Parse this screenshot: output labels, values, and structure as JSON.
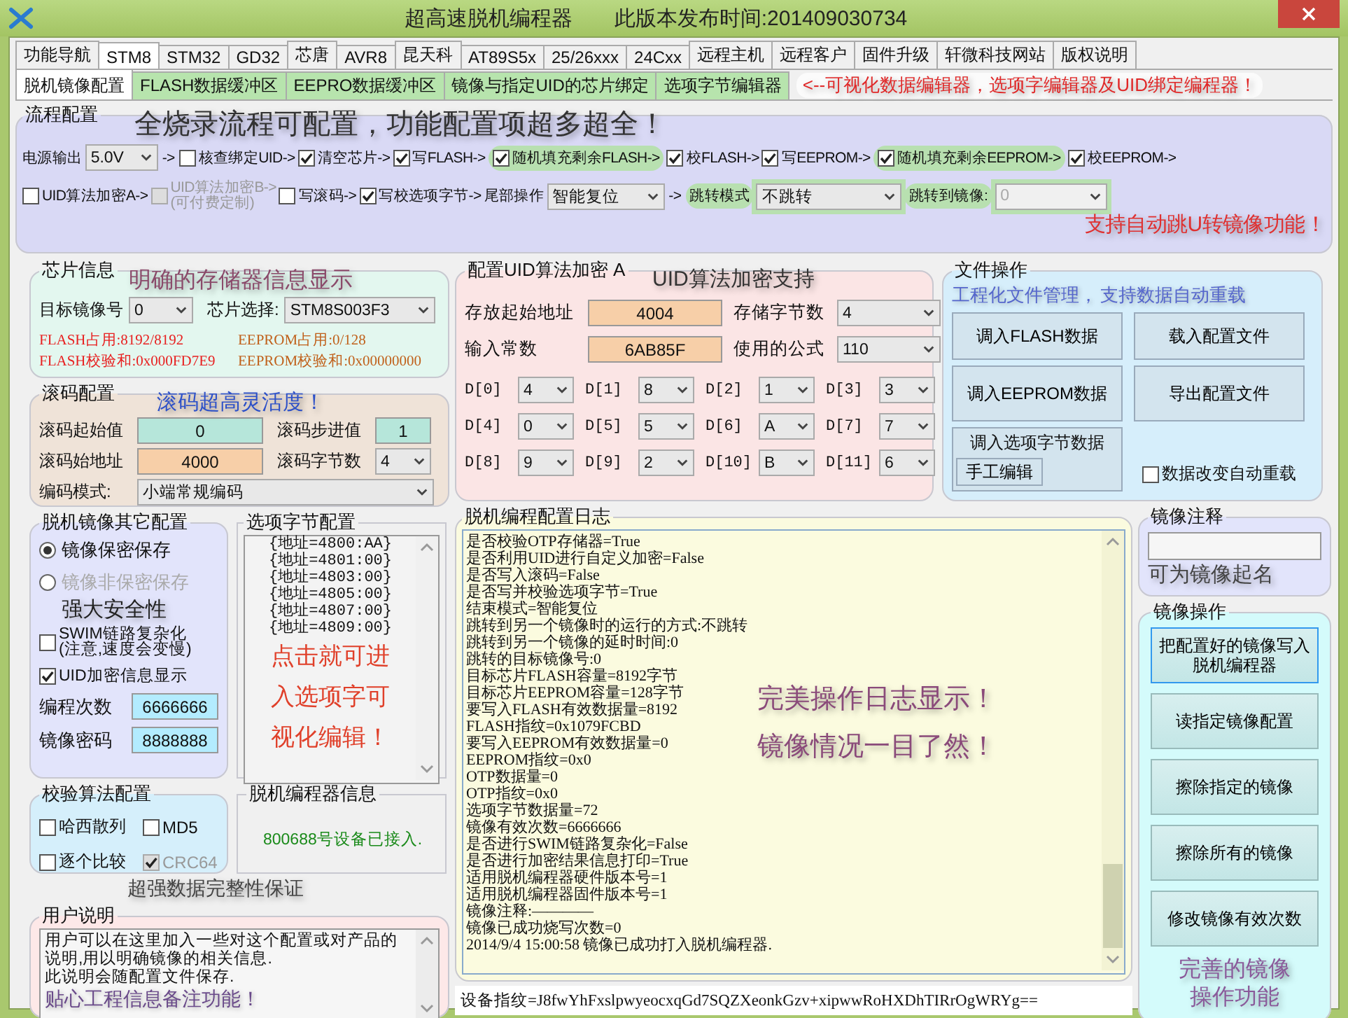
{
  "window": {
    "title": "超高速脱机编程器",
    "release": "此版本发布时间:201409030734"
  },
  "top_tabs": [
    {
      "label": "功能导航",
      "selected": false
    },
    {
      "label": "STM8",
      "selected": true
    },
    {
      "label": "STM32",
      "selected": false
    },
    {
      "label": "GD32",
      "selected": false
    },
    {
      "label": "芯唐",
      "selected": false
    },
    {
      "label": "AVR8",
      "selected": false
    },
    {
      "label": "昆天科",
      "selected": false
    },
    {
      "label": "AT89S5x",
      "selected": false
    },
    {
      "label": "25/26xxx",
      "selected": false
    },
    {
      "label": "24Cxx",
      "selected": false
    },
    {
      "label": "远程主机",
      "selected": false
    },
    {
      "label": "远程客户",
      "selected": false
    },
    {
      "label": "固件升级",
      "selected": false
    },
    {
      "label": "轩微科技网站",
      "selected": false
    },
    {
      "label": "版权说明",
      "selected": false
    }
  ],
  "sub_tabs": [
    {
      "label": "脱机镜像配置",
      "selected": true
    },
    {
      "label": "FLASH数据缓冲区",
      "selected": false
    },
    {
      "label": "EEPRO数据缓冲区",
      "selected": false
    },
    {
      "label": "镜像与指定UID的芯片绑定",
      "selected": false
    },
    {
      "label": "选项字节编辑器",
      "selected": false
    }
  ],
  "sub_tabs_callout": "<--可视化数据编辑器，选项字编辑器及UID绑定编程器！",
  "flow": {
    "title": "流程配置",
    "callout": "全烧录流程可配置，功能配置项超多超全！",
    "callout_2": "支持自动跳U转镜像功能！",
    "rows": [
      {
        "items": [
          {
            "kind": "label",
            "text": "电源输出",
            "highlight": false
          },
          {
            "kind": "select",
            "value": "5.0V",
            "disabled": false,
            "highlight": false
          },
          {
            "kind": "arrow",
            "text": "->"
          },
          {
            "kind": "check",
            "label": "核查绑定UID->",
            "checked": false,
            "disabled": false,
            "highlight": false
          },
          {
            "kind": "check",
            "label": "清空芯片->",
            "checked": true,
            "disabled": false,
            "highlight": false
          },
          {
            "kind": "check",
            "label": "写FLASH->",
            "checked": true,
            "disabled": false,
            "highlight": false
          },
          {
            "kind": "check",
            "label": "随机填充剩余FLASH->",
            "checked": true,
            "disabled": false,
            "highlight": true
          },
          {
            "kind": "check",
            "label": "校FLASH->",
            "checked": true,
            "disabled": false,
            "highlight": false
          },
          {
            "kind": "check",
            "label": "写EEPROM->",
            "checked": true,
            "disabled": false,
            "highlight": false
          },
          {
            "kind": "check",
            "label": "随机填充剩余EEPROM->",
            "checked": true,
            "disabled": false,
            "highlight": true
          },
          {
            "kind": "check",
            "label": "校EEPROM->",
            "checked": true,
            "disabled": false,
            "highlight": false
          }
        ]
      },
      {
        "items": [
          {
            "kind": "check",
            "label": "UID算法加密A->",
            "checked": false,
            "disabled": false,
            "highlight": false
          },
          {
            "kind": "check",
            "label": "UID算法加密B->",
            "note": "(可付费定制)",
            "checked": false,
            "disabled": true,
            "highlight": false
          },
          {
            "kind": "check",
            "label": "写滚码->",
            "checked": false,
            "disabled": false,
            "highlight": false
          },
          {
            "kind": "check",
            "label": "写校选项字节->",
            "checked": true,
            "disabled": false,
            "highlight": false
          },
          {
            "kind": "label",
            "text": "尾部操作",
            "highlight": false
          },
          {
            "kind": "select",
            "value": "智能复位",
            "disabled": false,
            "highlight": false
          },
          {
            "kind": "arrow",
            "text": "->"
          },
          {
            "kind": "label",
            "text": "跳转模式",
            "highlight": true
          },
          {
            "kind": "select",
            "value": "不跳转",
            "disabled": false,
            "highlight": true
          },
          {
            "kind": "label",
            "text": "跳转到镜像:",
            "highlight": true
          },
          {
            "kind": "select",
            "value": "0",
            "disabled": true,
            "highlight": true
          }
        ]
      }
    ]
  },
  "chip_info": {
    "title": "芯片信息",
    "callout": "明确的存储器信息显示",
    "target_label": "目标镜像号",
    "target_value": "0",
    "chip_label": "芯片选择:",
    "chip_value": "STM8S003F3",
    "stats": [
      {
        "text": "FLASH占用:8192/8192",
        "color": "#e82020"
      },
      {
        "text": "EEPROM占用:0/128",
        "color": "#c0601a"
      },
      {
        "text": "FLASH校验和:0x000FD7E9",
        "color": "#e82020"
      },
      {
        "text": "EEPROM校验和:0x00000000",
        "color": "#c0601a"
      }
    ]
  },
  "rolling": {
    "title": "滚码配置",
    "callout": "滚码超高灵活度！",
    "start": {
      "label": "滚码起始值",
      "value": "0"
    },
    "step": {
      "label": "滚码步进值",
      "value": "1"
    },
    "address": {
      "label": "滚码始地址",
      "value": "4000"
    },
    "bytes": {
      "label": "滚码字节数",
      "value": "4"
    },
    "mode": {
      "label": "编码模式:",
      "value": "小端常规编码"
    }
  },
  "uid": {
    "title": "配置UID算法加密 A",
    "callout": "UID算法加密支持",
    "store_addr": {
      "label": "存放起始地址",
      "value": "4004"
    },
    "store_bytes": {
      "label": "存储字节数",
      "value": "4"
    },
    "constant": {
      "label": "输入常数",
      "value": "6AB85F"
    },
    "formula": {
      "label": "使用的公式",
      "value": "110"
    },
    "d": [
      {
        "label": "D[0]",
        "value": "4"
      },
      {
        "label": "D[1]",
        "value": "8"
      },
      {
        "label": "D[2]",
        "value": "1"
      },
      {
        "label": "D[3]",
        "value": "3"
      },
      {
        "label": "D[4]",
        "value": "0"
      },
      {
        "label": "D[5]",
        "value": "5"
      },
      {
        "label": "D[6]",
        "value": "A"
      },
      {
        "label": "D[7]",
        "value": "7"
      },
      {
        "label": "D[8]",
        "value": "9"
      },
      {
        "label": "D[9]",
        "value": "2"
      },
      {
        "label": "D[10]",
        "value": "B"
      },
      {
        "label": "D[11]",
        "value": "6"
      }
    ]
  },
  "file_ops": {
    "title": "文件操作",
    "callout_lines": [
      "工程化文件管理，",
      "支持数据自动重载"
    ],
    "load_flash": "调入FLASH数据",
    "load_eeprom": "调入EEPROM数据",
    "load_option": "调入选项字节数据",
    "manual_edit": "手工编辑",
    "load_config": "载入配置文件",
    "export_config": "导出配置文件",
    "auto_reload": {
      "label": "数据改变自动重载",
      "checked": false
    }
  },
  "other_config": {
    "title": "脱机镜像其它配置",
    "callout": "强大安全性",
    "save_modes": [
      {
        "label": "镜像保密保存",
        "selected": true,
        "disabled": false
      },
      {
        "label": "镜像非保密保存",
        "selected": false,
        "disabled": true
      }
    ],
    "swim": {
      "label": "SWIM链路复杂化",
      "note": "(注意,速度会变慢)",
      "checked": false
    },
    "uid_show": {
      "label": "UID加密信息显示",
      "checked": true
    },
    "count": {
      "label": "编程次数",
      "value": "6666666"
    },
    "password": {
      "label": "镜像密码",
      "value": "8888888"
    }
  },
  "option_bytes": {
    "title": "选项字节配置",
    "lines": [
      "{地址=4800:AA}",
      "{地址=4801:00}",
      "{地址=4803:00}",
      "{地址=4805:00}",
      "{地址=4807:00}",
      "{地址=4809:00}"
    ],
    "callout_lines": [
      "点击就可进",
      "入选项字可",
      "视化编辑！"
    ]
  },
  "checksum": {
    "title": "校验算法配置",
    "callout": "超强数据完整性保证",
    "options": [
      {
        "label": "哈西散列",
        "checked": false,
        "disabled": false
      },
      {
        "label": "MD5",
        "checked": false,
        "disabled": false
      },
      {
        "label": "逐个比较",
        "checked": false,
        "disabled": false
      },
      {
        "label": "CRC64",
        "checked": true,
        "disabled": true
      }
    ]
  },
  "programmer_info": {
    "title": "脱机编程器信息",
    "status": "800688号设备已接入."
  },
  "user_notes": {
    "title": "用户说明",
    "lines": [
      "用户可以在这里加入一些对这个配置或对产品的",
      "说明,用以明确镜像的相关信息.",
      "此说明会随配置文件保存."
    ],
    "callout": "贴心工程信息备注功能！"
  },
  "log": {
    "title": "脱机编程配置日志",
    "callout_lines": [
      "完美操作日志显示！",
      "镜像情况一目了然！"
    ],
    "lines": [
      "是否校验OTP存储器=True",
      "是否利用UID进行自定义加密=False",
      "是否写入滚码=False",
      "是否写并校验选项字节=True",
      "结束模式=智能复位",
      "跳转到另一个镜像时的运行的方式:不跳转",
      "跳转到另一个镜像的延时时间:0",
      "跳转的目标镜像号:0",
      "目标芯片FLASH容量=8192字节",
      "目标芯片EEPROM容量=128字节",
      "要写入FLASH有效数据量=8192",
      "FLASH指纹=0x1079FCBD",
      "要写入EEPROM有效数据量=0",
      "EEPROM指纹=0x0",
      "OTP数据量=0",
      "OTP指纹=0x0",
      "选项字节数据量=72",
      "镜像有效次数=6666666",
      "是否进行SWIM链路复杂化=False",
      "是否进行加密结果信息打印=True",
      "适用脱机编程器硬件版本号=1",
      "适用脱机编程器固件版本号=1",
      "镜像注释:————",
      "镜像已成功烧写次数=0",
      "2014/9/4 15:00:58 镜像已成功打入脱机编程器."
    ],
    "fingerprint": "设备指纹=J8fwYhFxslpwyeocxqGd7SQZXeonkGzv+xipwwRoHXDhTIRrOgWRYg=="
  },
  "image_note": {
    "title": "镜像注释",
    "callout": "可为镜像起名"
  },
  "image_ops": {
    "title": "镜像操作",
    "callout_lines": [
      "完善的镜像",
      "操作功能"
    ],
    "buttons": [
      {
        "label": "把配置好的镜像写入脱机编程器",
        "focused": true
      },
      {
        "label": "读指定镜像配置",
        "focused": false
      },
      {
        "label": "擦除指定的镜像",
        "focused": false
      },
      {
        "label": "擦除所有的镜像",
        "focused": false
      },
      {
        "label": "修改镜像有效次数",
        "focused": false
      }
    ]
  }
}
